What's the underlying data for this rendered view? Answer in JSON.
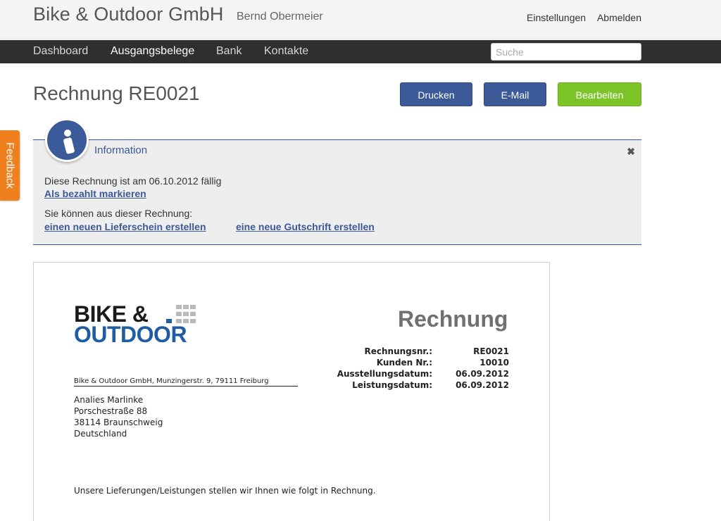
{
  "header": {
    "company": "Bike & Outdoor GmbH",
    "user": "Bernd Obermeier",
    "settings_link": "Einstellungen",
    "logout_link": "Abmelden"
  },
  "nav": {
    "items": [
      "Dashboard",
      "Ausgangsbelege",
      "Bank",
      "Kontakte"
    ],
    "active": "Ausgangsbelege",
    "search_placeholder": "Suche"
  },
  "page": {
    "title": "Rechnung RE0021",
    "buttons": {
      "print": "Drucken",
      "email": "E-Mail",
      "edit": "Bearbeiten"
    }
  },
  "info": {
    "title": "Information",
    "close_symbol": "✖",
    "due_text": "Diese Rechnung ist am 06.10.2012 fällig",
    "mark_paid_link": "Als bezahlt markieren",
    "options_text": "Sie können aus dieser Rechnung:",
    "delivery_note_link": "einen neuen Lieferschein erstellen",
    "credit_note_link": "eine neue Gutschrift erstellen"
  },
  "feedback": {
    "label": "Feedback"
  },
  "document": {
    "logo_line1": "BIKE &",
    "logo_line2": "OUTDOOR",
    "heading": "Rechnung",
    "meta": [
      {
        "label": "Rechnungsnr.:",
        "value": "RE0021"
      },
      {
        "label": "Kunden Nr.:",
        "value": "10010"
      },
      {
        "label": "Ausstellungsdatum:",
        "value": "06.09.2012"
      },
      {
        "label": "Leistungsdatum:",
        "value": "06.09.2012"
      }
    ],
    "sender_line": "Bike & Outdoor GmbH, Munzingerstr. 9, 79111 Freiburg",
    "recipient": [
      "Analies Marlinke",
      "Porschestraße 88",
      "38114 Braunschweig",
      "Deutschland"
    ],
    "intro": "Unsere Lieferungen/Leistungen stellen wir Ihnen wie folgt in Rechnung."
  },
  "colors": {
    "brand_blue": "#3c5a97",
    "edit_green": "#7cc427",
    "feedback_orange": "#f07f1e",
    "nav_dark": "#2f2f2f",
    "logo_blue": "#1e5da6"
  },
  "icons": {
    "info": "info-circle-icon",
    "close": "close-icon"
  }
}
